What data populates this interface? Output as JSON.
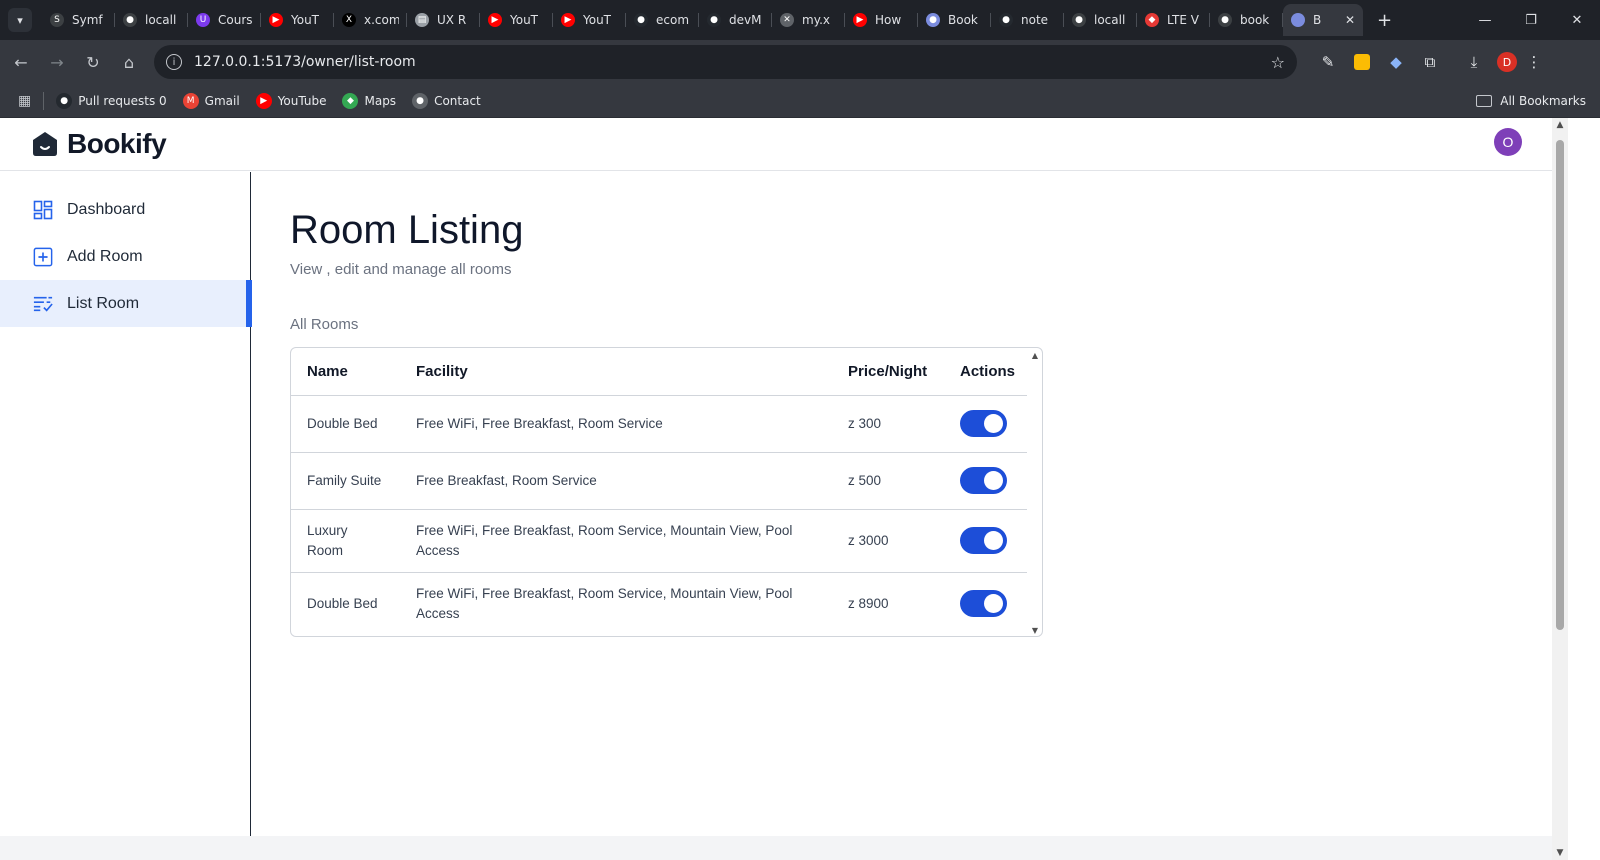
{
  "browser": {
    "tabs": [
      {
        "title": "Symf",
        "color": "#3c4043",
        "glyph": "S"
      },
      {
        "title": "locall",
        "color": "#3c4043",
        "glyph": "●"
      },
      {
        "title": "Cours",
        "color": "#7c3aed",
        "glyph": "U"
      },
      {
        "title": "YouT",
        "color": "#ff0000",
        "glyph": "▶"
      },
      {
        "title": "x.com",
        "color": "#000000",
        "glyph": "X"
      },
      {
        "title": "UX R",
        "color": "#9aa0a6",
        "glyph": "▤"
      },
      {
        "title": "YouT",
        "color": "#ff0000",
        "glyph": "▶"
      },
      {
        "title": "YouT",
        "color": "#ff0000",
        "glyph": "▶"
      },
      {
        "title": "ecom",
        "color": "#24292f",
        "glyph": "●"
      },
      {
        "title": "devM",
        "color": "#24292f",
        "glyph": "●"
      },
      {
        "title": "my.x",
        "color": "#5f6368",
        "glyph": "✕"
      },
      {
        "title": "How",
        "color": "#ff0000",
        "glyph": "▶"
      },
      {
        "title": "Book",
        "color": "#7b8cde",
        "glyph": "●"
      },
      {
        "title": "note",
        "color": "#24292f",
        "glyph": "●"
      },
      {
        "title": "locall",
        "color": "#3c4043",
        "glyph": "●"
      },
      {
        "title": "LTE V",
        "color": "#e53935",
        "glyph": "◆"
      },
      {
        "title": "book",
        "color": "#3c4043",
        "glyph": "●"
      }
    ],
    "active_tab": {
      "title": "B",
      "color": "#7b8cde"
    },
    "url": "127.0.0.1:5173/owner/list-room",
    "bookmarks": [
      {
        "label": "Pull requests 0",
        "color": "#24292f",
        "glyph": "●"
      },
      {
        "label": "Gmail",
        "color": "#ea4335",
        "glyph": "M"
      },
      {
        "label": "YouTube",
        "color": "#ff0000",
        "glyph": "▶"
      },
      {
        "label": "Maps",
        "color": "#34a853",
        "glyph": "◆"
      },
      {
        "label": "Contact",
        "color": "#5f6368",
        "glyph": "●"
      }
    ],
    "all_bookmarks": "All Bookmarks",
    "profile_initial": "D"
  },
  "app": {
    "brand": "Bookify",
    "avatar_initial": "O",
    "accent": "#2563eb"
  },
  "sidebar": {
    "items": [
      {
        "label": "Dashboard",
        "icon": "dashboard-icon"
      },
      {
        "label": "Add Room",
        "icon": "add-box-icon"
      },
      {
        "label": "List Room",
        "icon": "list-icon",
        "active": true
      }
    ]
  },
  "main": {
    "title": "Room Listing",
    "subtitle": "View , edit and manage all rooms",
    "section": "All Rooms",
    "table": {
      "headers": [
        "Name",
        "Facility",
        "Price/Night",
        "Actions"
      ],
      "rows": [
        {
          "name": "Double Bed",
          "facility": "Free WiFi, Free Breakfast, Room Service",
          "price": "z 300",
          "enabled": true
        },
        {
          "name": "Family Suite",
          "facility": "Free Breakfast, Room Service",
          "price": "z 500",
          "enabled": true
        },
        {
          "name": "Luxury Room",
          "facility": "Free WiFi, Free Breakfast, Room Service, Mountain View, Pool Access",
          "price": "z 3000",
          "enabled": true
        },
        {
          "name": "Double Bed",
          "facility": "Free WiFi, Free Breakfast, Room Service, Mountain View, Pool Access",
          "price": "z 8900",
          "enabled": true
        }
      ]
    }
  }
}
